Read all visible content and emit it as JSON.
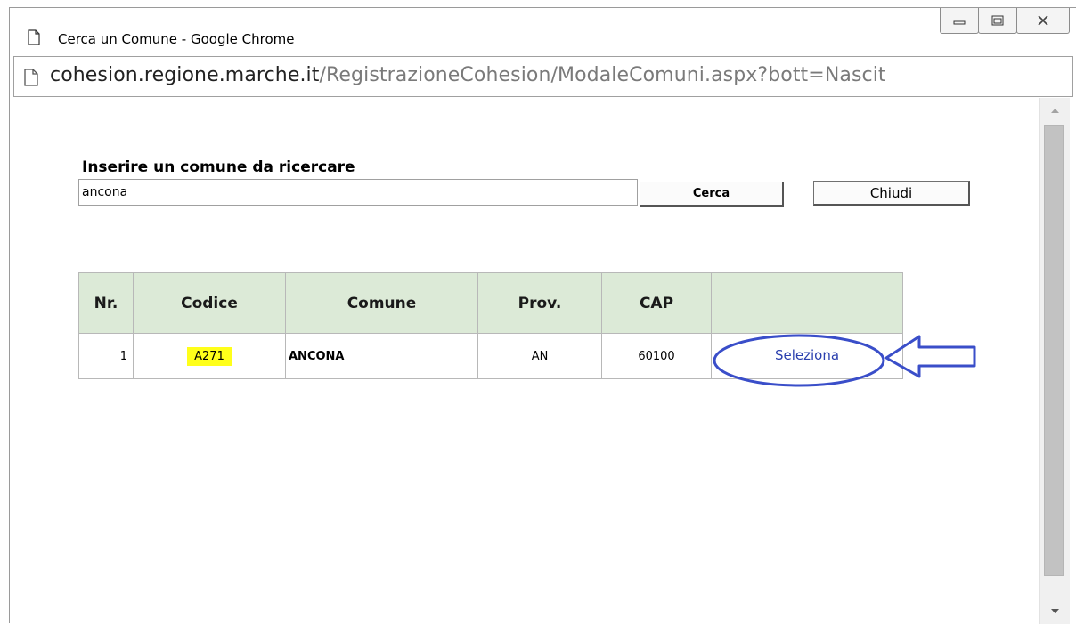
{
  "window": {
    "title": "Cerca un Comune - Google Chrome"
  },
  "address_bar": {
    "host": "cohesion.regione.marche.it",
    "path": "/RegistrazioneCohesion/ModaleComuni.aspx?bott=Nascit"
  },
  "search": {
    "label": "Inserire un comune da ricercare",
    "value": "ancona",
    "search_button": "Cerca",
    "close_button": "Chiudi"
  },
  "table": {
    "headers": [
      "Nr.",
      "Codice",
      "Comune",
      "Prov.",
      "CAP",
      ""
    ],
    "rows": [
      {
        "nr": "1",
        "codice": "A271",
        "comune": "ANCONA",
        "prov": "AN",
        "cap": "60100",
        "action": "Seleziona"
      }
    ]
  },
  "colors": {
    "header_bg": "#dcead7",
    "highlight": "#ffff1a",
    "link": "#2a3fae",
    "annotation": "#3a4ec9"
  }
}
